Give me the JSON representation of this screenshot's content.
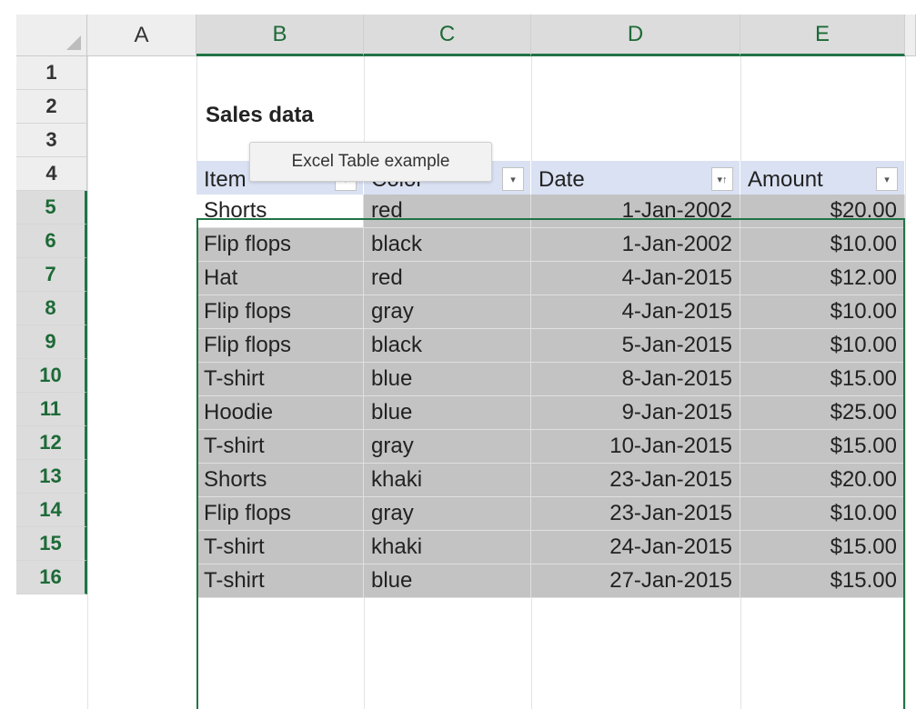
{
  "columns": [
    "A",
    "B",
    "C",
    "D",
    "E"
  ],
  "rows": [
    "1",
    "2",
    "3",
    "4",
    "5",
    "6",
    "7",
    "8",
    "9",
    "10",
    "11",
    "12",
    "13",
    "14",
    "15",
    "16"
  ],
  "title": "Sales data",
  "tooltip": "Excel Table example",
  "table": {
    "headers": [
      "Item",
      "Color",
      "Date",
      "Amount"
    ],
    "filter_icons": [
      "dropdown-arrow-icon",
      "dropdown-arrow-icon",
      "sort-ascending-filter-icon",
      "dropdown-arrow-icon"
    ],
    "rows": [
      [
        "Shorts",
        "red",
        "1-Jan-2002",
        "$20.00"
      ],
      [
        "Flip flops",
        "black",
        "1-Jan-2002",
        "$10.00"
      ],
      [
        "Hat",
        "red",
        "4-Jan-2015",
        "$12.00"
      ],
      [
        "Flip flops",
        "gray",
        "4-Jan-2015",
        "$10.00"
      ],
      [
        "Flip flops",
        "black",
        "5-Jan-2015",
        "$10.00"
      ],
      [
        "T-shirt",
        "blue",
        "8-Jan-2015",
        "$15.00"
      ],
      [
        "Hoodie",
        "blue",
        "9-Jan-2015",
        "$25.00"
      ],
      [
        "T-shirt",
        "gray",
        "10-Jan-2015",
        "$15.00"
      ],
      [
        "Shorts",
        "khaki",
        "23-Jan-2015",
        "$20.00"
      ],
      [
        "Flip flops",
        "gray",
        "23-Jan-2015",
        "$10.00"
      ],
      [
        "T-shirt",
        "khaki",
        "24-Jan-2015",
        "$15.00"
      ],
      [
        "T-shirt",
        "blue",
        "27-Jan-2015",
        "$15.00"
      ]
    ]
  },
  "colors": {
    "selection_accent": "#217346",
    "header_fill": "#d9e1f2",
    "selected_cell_fill": "#c3c3c3"
  }
}
